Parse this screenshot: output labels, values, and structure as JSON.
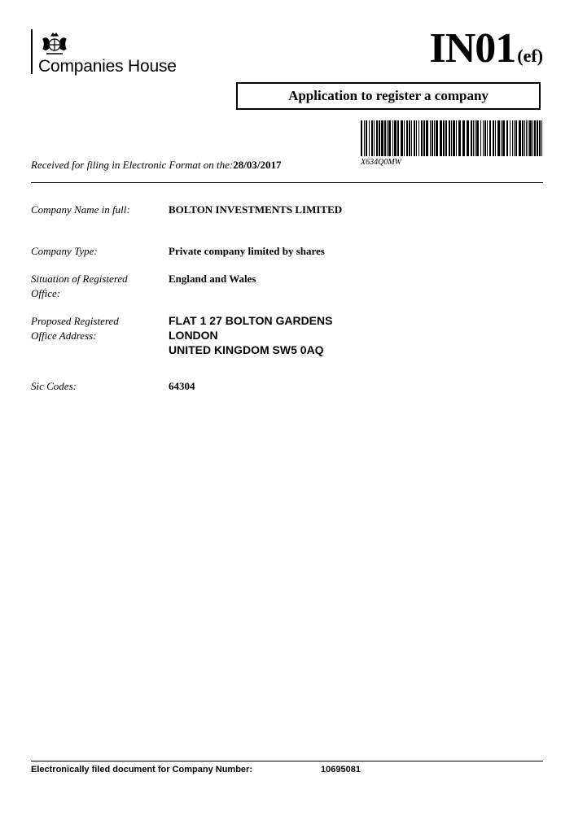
{
  "header": {
    "brand": "Companies House",
    "form_code": "IN01",
    "form_suffix": "(ef)",
    "title": "Application to register a company",
    "crest_icon": "royal-crest-icon"
  },
  "barcode": {
    "text": "X634Q0MW"
  },
  "received": {
    "label": "Received for filing in Electronic Format on the:",
    "date": "28/03/2017"
  },
  "fields": {
    "company_name": {
      "label": "Company Name in full:",
      "value": "BOLTON INVESTMENTS LIMITED"
    },
    "company_type": {
      "label": "Company Type:",
      "value": "Private company limited by shares"
    },
    "situation": {
      "label": "Situation of Registered Office:",
      "value": "England and Wales"
    },
    "address": {
      "label": "Proposed Registered Office Address:",
      "lines": [
        "FLAT 1 27 BOLTON GARDENS",
        "LONDON",
        "UNITED KINGDOM SW5 0AQ"
      ]
    },
    "sic": {
      "label": "Sic Codes:",
      "value": "64304"
    }
  },
  "footer": {
    "label": "Electronically filed document for Company Number:",
    "company_number": "10695081"
  }
}
